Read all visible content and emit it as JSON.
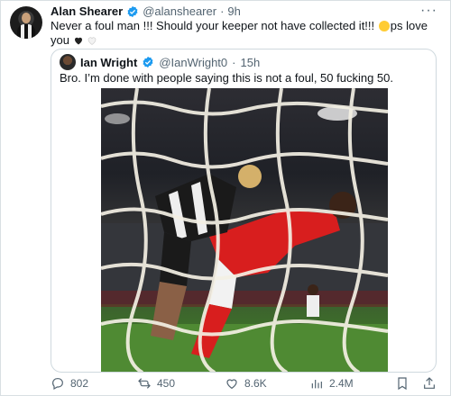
{
  "tweet": {
    "author_name": "Alan Shearer",
    "author_handle": "@alanshearer",
    "separator": "·",
    "time": "9h",
    "text_part1": "Never a foul man !!! Should your keeper not have collected it!!!",
    "text_part2": "ps love you",
    "more_icon": "more-horizontal-icon"
  },
  "quote": {
    "author_name": "Ian Wright",
    "author_handle": "@IanWright0",
    "separator": "·",
    "time": "15h",
    "text": "Bro. I’m done with people saying this is not a foul, 50 fucking 50."
  },
  "actions": {
    "replies": "802",
    "reposts": "450",
    "likes": "8.6K",
    "views": "2.4M"
  },
  "colors": {
    "verified": "#1d9bf0",
    "muted": "#536471",
    "arsenal_red": "#d81e1e",
    "pitch_green": "#4f8a33"
  }
}
